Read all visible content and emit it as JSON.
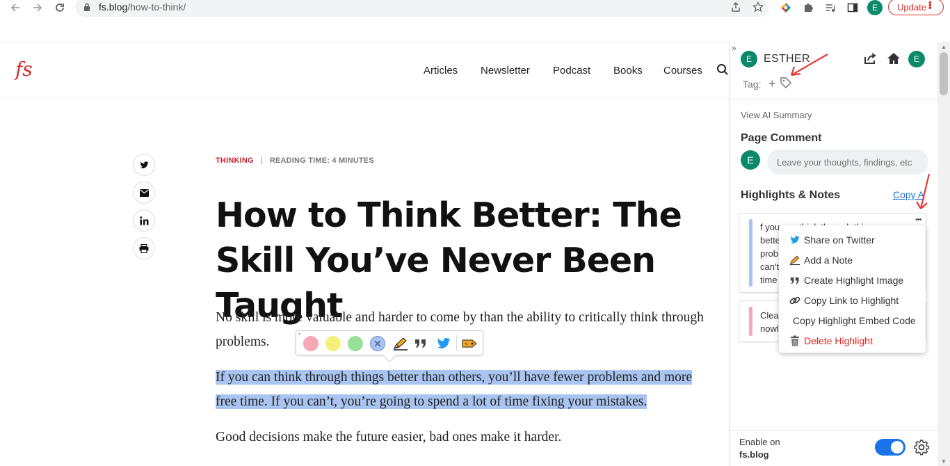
{
  "browser": {
    "url_domain": "fs.blog",
    "url_path": "/how-to-think/",
    "profile_initial": "E",
    "update_label": "Update"
  },
  "site": {
    "logo": "fs",
    "nav": [
      "Articles",
      "Newsletter",
      "Podcast",
      "Books",
      "Courses"
    ]
  },
  "article": {
    "category": "THINKING",
    "separator": "|",
    "reading_time": "READING TIME: 4 MINUTES",
    "title": "How to Think Better: The Skill You’ve Never Been Taught",
    "para1_line1": "No skill is more valuable and harder to come by than the ability to critically think through",
    "para1_line2": "problems.",
    "para2_line1": "If you can think through things better than others, you’ll have fewer problems and more",
    "para2_line2": "free time. If you can’t, you’re going to spend a lot of time fixing your mistakes.",
    "para3": "Good decisions make the future easier, bad ones make it harder."
  },
  "highlight_toolbar": {
    "close_glyph": "×",
    "colors": [
      "#f7a8b8",
      "#f5f07a",
      "#98e098",
      "#a9c4f0"
    ]
  },
  "sidebar": {
    "collapse_glyph": "»",
    "user_initial": "E",
    "user_name": "ESTHER",
    "tag_label": "Tag:",
    "tag_add": "+",
    "ai_summary": "View AI Summary",
    "page_comment_title": "Page Comment",
    "comment_placeholder": "Leave your thoughts, findings, etc",
    "highlights_title": "Highlights & Notes",
    "copy_all": "Copy A",
    "cards": [
      {
        "color": "#a9c4f0",
        "lines": [
          "f you can think through things",
          "bette",
          "prob",
          "can't",
          "time"
        ]
      },
      {
        "color": "#f7a8b8",
        "lines": [
          "Clea",
          "nowl"
        ]
      }
    ],
    "context_menu": [
      "Share on Twitter",
      "Add a Note",
      "Create Highlight Image",
      "Copy Link to Highlight",
      "Copy Highlight Embed Code",
      "Delete Highlight"
    ],
    "enable_on": "Enable on",
    "enable_site": "fs.blog"
  }
}
